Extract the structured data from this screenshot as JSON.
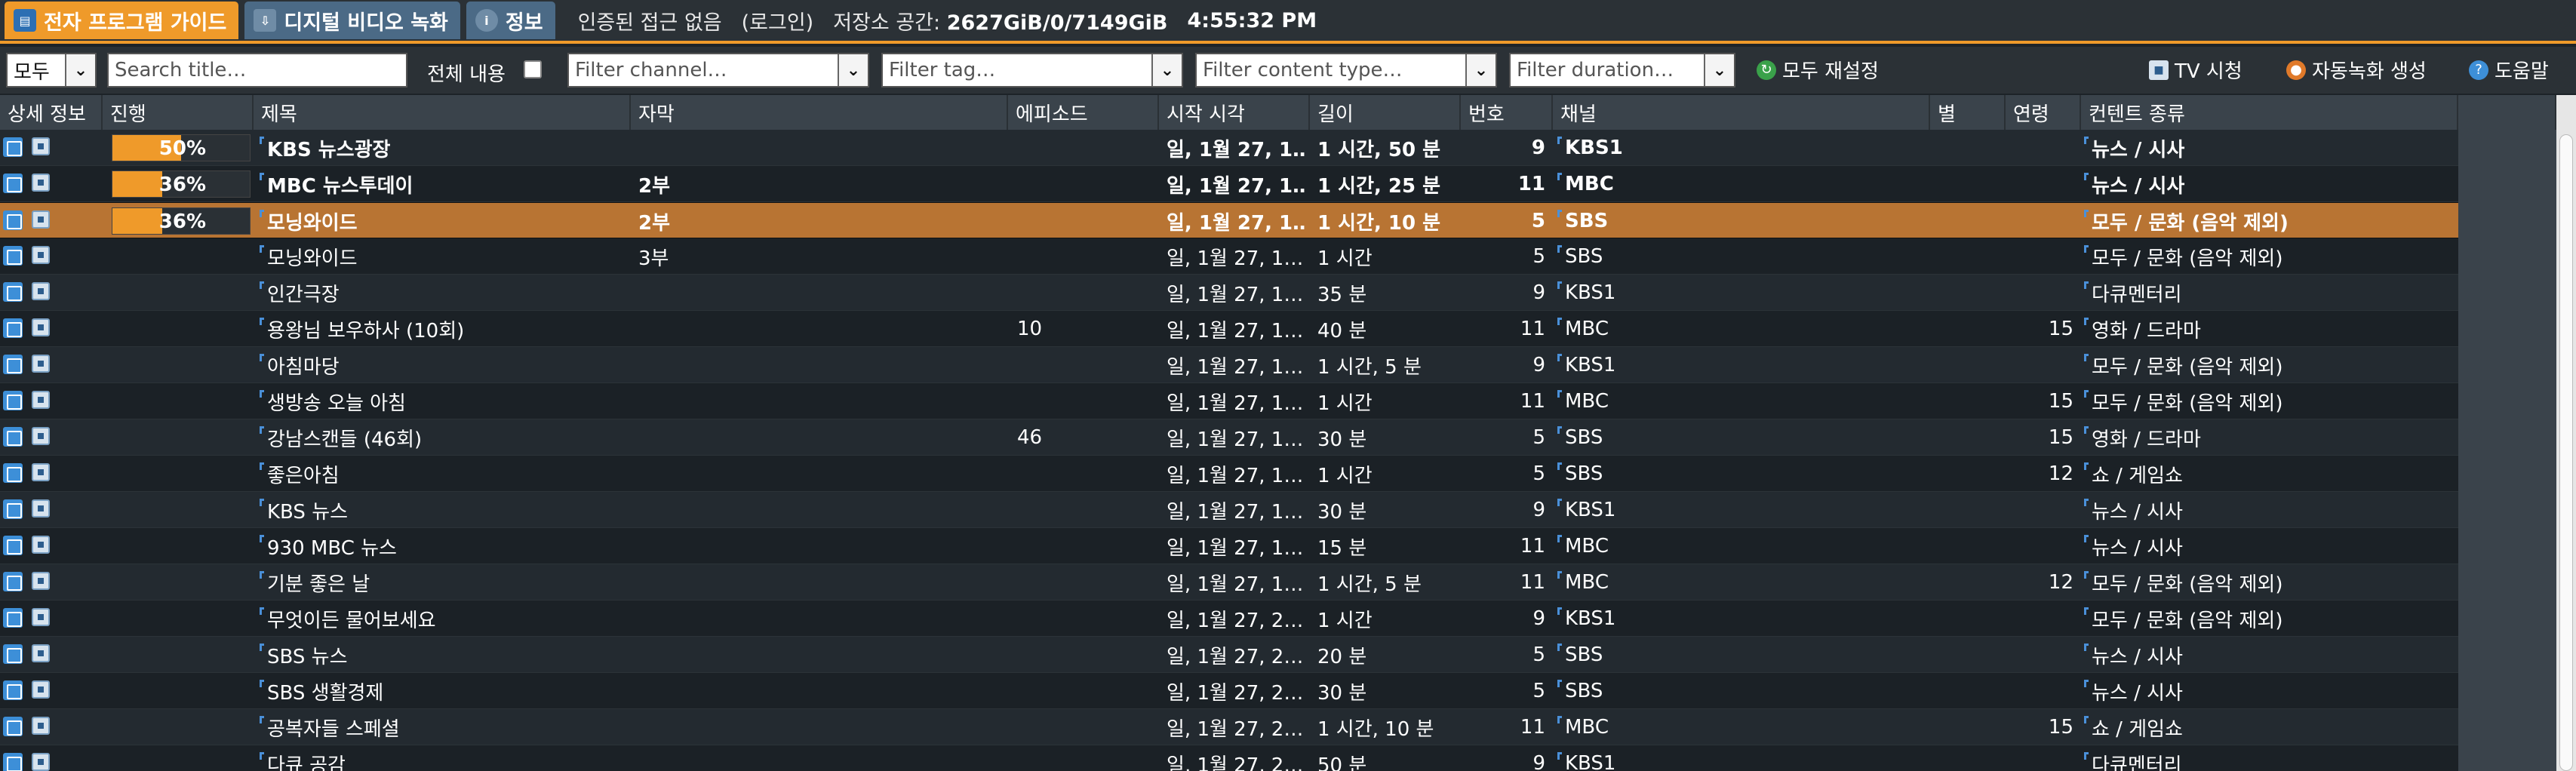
{
  "tabs": [
    {
      "label": "전자 프로그램 가이드",
      "icon": "epg-icon",
      "active": true
    },
    {
      "label": "디지털 비디오 녹화",
      "icon": "dvr-icon",
      "active": false
    },
    {
      "label": "정보",
      "icon": "info-icon",
      "active": false
    }
  ],
  "status": {
    "auth": "인증된 접근 없음",
    "login": "(로그인)",
    "storage_label": "저장소 공간:",
    "storage_value": "2627GiB/0/7149GiB",
    "time": "4:55:32 PM"
  },
  "filters": {
    "scope": "모두",
    "search_placeholder": "Search title…",
    "fulltext_label": "전체 내용",
    "channel_placeholder": "Filter channel…",
    "tag_placeholder": "Filter tag…",
    "content_type_placeholder": "Filter content type…",
    "duration_placeholder": "Filter duration…",
    "reset_all": "모두 재설정",
    "watch_tv": "TV 시청",
    "autorec": "자동녹화 생성",
    "help": "도움말"
  },
  "columns": {
    "details": "상세 정보",
    "progress": "진행",
    "title": "제목",
    "subtitle": "자막",
    "episode": "에피소드",
    "start": "시작 시각",
    "duration": "길이",
    "number": "번호",
    "channel": "채널",
    "stars": "별",
    "age": "연령",
    "content_type": "컨텐트 종류"
  },
  "rows": [
    {
      "progress": "50%",
      "progress_value": 0.5,
      "title": "KBS 뉴스광장",
      "subtitle": "",
      "episode": "",
      "start": "일, 1월 27, 1…",
      "duration": "1 시간, 50 분",
      "number": "9",
      "channel": "KBS1",
      "stars": "",
      "age": "",
      "content_type": "뉴스 / 시사",
      "bold": true,
      "selected": false
    },
    {
      "progress": "36%",
      "progress_value": 0.36,
      "title": "MBC 뉴스투데이",
      "subtitle": "2부",
      "episode": "",
      "start": "일, 1월 27, 1…",
      "duration": "1 시간, 25 분",
      "number": "11",
      "channel": "MBC",
      "stars": "",
      "age": "",
      "content_type": "뉴스 / 시사",
      "bold": true,
      "selected": false
    },
    {
      "progress": "36%",
      "progress_value": 0.36,
      "title": "모닝와이드",
      "subtitle": "2부",
      "episode": "",
      "start": "일, 1월 27, 1…",
      "duration": "1 시간, 10 분",
      "number": "5",
      "channel": "SBS",
      "stars": "",
      "age": "",
      "content_type": "모두 / 문화 (음악 제외)",
      "bold": true,
      "selected": true
    },
    {
      "progress": "",
      "title": "모닝와이드",
      "subtitle": "3부",
      "episode": "",
      "start": "일, 1월 27, 1…",
      "duration": "1 시간",
      "number": "5",
      "channel": "SBS",
      "stars": "",
      "age": "",
      "content_type": "모두 / 문화 (음악 제외)"
    },
    {
      "progress": "",
      "title": "인간극장",
      "subtitle": "",
      "episode": "",
      "start": "일, 1월 27, 1…",
      "duration": "35 분",
      "number": "9",
      "channel": "KBS1",
      "stars": "",
      "age": "",
      "content_type": "다큐멘터리"
    },
    {
      "progress": "",
      "title": "용왕님 보우하사 (10회)",
      "subtitle": "",
      "episode": "10",
      "start": "일, 1월 27, 1…",
      "duration": "40 분",
      "number": "11",
      "channel": "MBC",
      "stars": "",
      "age": "15",
      "content_type": "영화 / 드라마"
    },
    {
      "progress": "",
      "title": "아침마당",
      "subtitle": "",
      "episode": "",
      "start": "일, 1월 27, 1…",
      "duration": "1 시간, 5 분",
      "number": "9",
      "channel": "KBS1",
      "stars": "",
      "age": "",
      "content_type": "모두 / 문화 (음악 제외)"
    },
    {
      "progress": "",
      "title": "생방송 오늘 아침",
      "subtitle": "",
      "episode": "",
      "start": "일, 1월 27, 1…",
      "duration": "1 시간",
      "number": "11",
      "channel": "MBC",
      "stars": "",
      "age": "15",
      "content_type": "모두 / 문화 (음악 제외)"
    },
    {
      "progress": "",
      "title": "강남스캔들 (46회)",
      "subtitle": "",
      "episode": "46",
      "start": "일, 1월 27, 1…",
      "duration": "30 분",
      "number": "5",
      "channel": "SBS",
      "stars": "",
      "age": "15",
      "content_type": "영화 / 드라마"
    },
    {
      "progress": "",
      "title": "좋은아침",
      "subtitle": "",
      "episode": "",
      "start": "일, 1월 27, 1…",
      "duration": "1 시간",
      "number": "5",
      "channel": "SBS",
      "stars": "",
      "age": "12",
      "content_type": "쇼 / 게임쇼"
    },
    {
      "progress": "",
      "title": "KBS 뉴스",
      "subtitle": "",
      "episode": "",
      "start": "일, 1월 27, 1…",
      "duration": "30 분",
      "number": "9",
      "channel": "KBS1",
      "stars": "",
      "age": "",
      "content_type": "뉴스 / 시사"
    },
    {
      "progress": "",
      "title": "930 MBC 뉴스",
      "subtitle": "",
      "episode": "",
      "start": "일, 1월 27, 1…",
      "duration": "15 분",
      "number": "11",
      "channel": "MBC",
      "stars": "",
      "age": "",
      "content_type": "뉴스 / 시사"
    },
    {
      "progress": "",
      "title": "기분 좋은 날",
      "subtitle": "",
      "episode": "",
      "start": "일, 1월 27, 1…",
      "duration": "1 시간, 5 분",
      "number": "11",
      "channel": "MBC",
      "stars": "",
      "age": "12",
      "content_type": "모두 / 문화 (음악 제외)"
    },
    {
      "progress": "",
      "title": "무엇이든 물어보세요",
      "subtitle": "",
      "episode": "",
      "start": "일, 1월 27, 2…",
      "duration": "1 시간",
      "number": "9",
      "channel": "KBS1",
      "stars": "",
      "age": "",
      "content_type": "모두 / 문화 (음악 제외)"
    },
    {
      "progress": "",
      "title": "SBS 뉴스",
      "subtitle": "",
      "episode": "",
      "start": "일, 1월 27, 2…",
      "duration": "20 분",
      "number": "5",
      "channel": "SBS",
      "stars": "",
      "age": "",
      "content_type": "뉴스 / 시사"
    },
    {
      "progress": "",
      "title": "SBS 생활경제",
      "subtitle": "",
      "episode": "",
      "start": "일, 1월 27, 2…",
      "duration": "30 분",
      "number": "5",
      "channel": "SBS",
      "stars": "",
      "age": "",
      "content_type": "뉴스 / 시사"
    },
    {
      "progress": "",
      "title": "공복자들 스페셜",
      "subtitle": "",
      "episode": "",
      "start": "일, 1월 27, 2…",
      "duration": "1 시간, 10 분",
      "number": "11",
      "channel": "MBC",
      "stars": "",
      "age": "15",
      "content_type": "쇼 / 게임쇼"
    },
    {
      "progress": "",
      "title": "다큐 공감",
      "subtitle": "",
      "episode": "",
      "start": "일, 1월 27, 2…",
      "duration": "50 분",
      "number": "9",
      "channel": "KBS1",
      "stars": "",
      "age": "",
      "content_type": "다큐멘터리"
    }
  ],
  "colors": {
    "accent": "#ef9a2a",
    "selected_row": "#b87433",
    "header": "#3a434b",
    "tab_inactive": "#4b6a86"
  }
}
